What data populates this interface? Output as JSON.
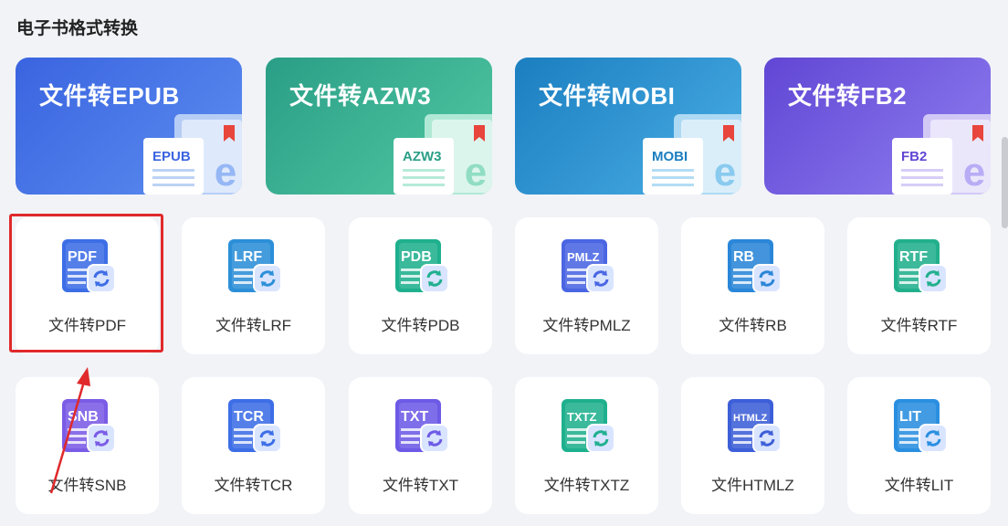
{
  "section_title": "电子书格式转换",
  "banners": [
    {
      "title": "文件转EPUB",
      "tag": "EPUB",
      "c1": "#3a64e0",
      "c2": "#5c8ef0",
      "book": "#bcd2f5"
    },
    {
      "title": "文件转AZW3",
      "tag": "AZW3",
      "c1": "#2a9e86",
      "c2": "#52c9a3",
      "book": "#b6ead9"
    },
    {
      "title": "文件转MOBI",
      "tag": "MOBI",
      "c1": "#1b7ec0",
      "c2": "#4aaee5",
      "book": "#b3dcf4"
    },
    {
      "title": "文件转FB2",
      "tag": "FB2",
      "c1": "#6146d4",
      "c2": "#8f7ff0",
      "book": "#d6cdf7"
    }
  ],
  "cards": [
    {
      "label": "文件转PDF",
      "tag": "PDF",
      "color": "#3d6ee6",
      "icon": "pdf-file-icon"
    },
    {
      "label": "文件转LRF",
      "tag": "LRF",
      "color": "#2c8fd8",
      "icon": "lrf-file-icon"
    },
    {
      "label": "文件转PDB",
      "tag": "PDB",
      "color": "#1fb08e",
      "icon": "pdb-file-icon"
    },
    {
      "label": "文件转PMLZ",
      "tag": "PMLZ",
      "color": "#4a66e3",
      "icon": "pmlz-file-icon"
    },
    {
      "label": "文件转RB",
      "tag": "RB",
      "color": "#2a86d8",
      "icon": "rb-file-icon"
    },
    {
      "label": "文件转RTF",
      "tag": "RTF",
      "color": "#22b08c",
      "icon": "rtf-file-icon"
    },
    {
      "label": "文件转SNB",
      "tag": "SNB",
      "color": "#7a5ce6",
      "icon": "snb-file-icon"
    },
    {
      "label": "文件转TCR",
      "tag": "TCR",
      "color": "#3d6ee6",
      "icon": "tcr-file-icon"
    },
    {
      "label": "文件转TXT",
      "tag": "TXT",
      "color": "#6d5ae6",
      "icon": "txt-file-icon"
    },
    {
      "label": "文件转TXTZ",
      "tag": "TXTZ",
      "color": "#1fb08e",
      "icon": "txtz-file-icon"
    },
    {
      "label": "文件HTMLZ",
      "tag": "HTMLZ",
      "color": "#3d5fd8",
      "icon": "htmlz-file-icon"
    },
    {
      "label": "文件转LIT",
      "tag": "LIT",
      "color": "#2a8fe0",
      "icon": "lit-file-icon"
    }
  ],
  "highlight_color": "#e0292b"
}
